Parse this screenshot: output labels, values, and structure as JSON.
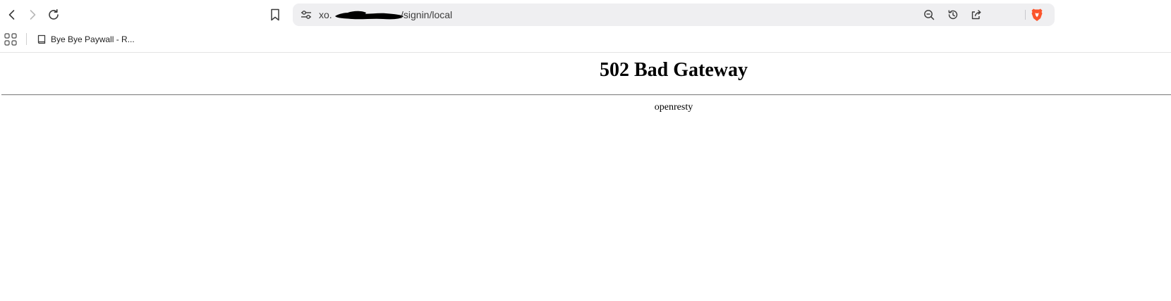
{
  "toolbar": {
    "back_icon": "back-arrow-icon",
    "forward_icon": "forward-arrow-icon",
    "reload_icon": "reload-icon",
    "bookmark_icon": "bookmark-icon"
  },
  "address_bar": {
    "host_visible": "xo.",
    "path": "/signin/local",
    "site_info_icon": "site-settings-icon",
    "right_icons": [
      "zoom-out-icon",
      "history-icon",
      "share-icon",
      "brave-shields-icon"
    ],
    "brand_color": "#fb542b"
  },
  "bookmarks_bar": {
    "apps_icon": "apps-grid-icon",
    "items": [
      {
        "label": "Bye Bye Paywall - R...",
        "icon": "book-icon"
      }
    ]
  },
  "page": {
    "heading": "502 Bad Gateway",
    "server": "openresty"
  }
}
